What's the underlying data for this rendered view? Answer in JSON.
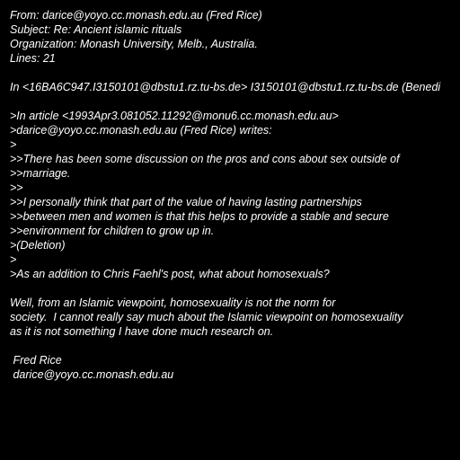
{
  "email": {
    "headers": {
      "from": "From: darice@yoyo.cc.monash.edu.au (Fred Rice)",
      "subject": "Subject: Re: Ancient islamic rituals",
      "organization": "Organization: Monash University, Melb., Australia.",
      "lines": "Lines: 21"
    },
    "in_reply_to": "In <16BA6C947.I3150101@dbstu1.rz.tu-bs.de> I3150101@dbstu1.rz.tu-bs.de (Benedi",
    "quoted": [
      ">In article <1993Apr3.081052.11292@monu6.cc.monash.edu.au>",
      ">darice@yoyo.cc.monash.edu.au (Fred Rice) writes:",
      ">",
      ">>There has been some discussion on the pros and cons about sex outside of",
      ">>marriage.",
      ">>",
      ">>I personally think that part of the value of having lasting partnerships",
      ">>between men and women is that this helps to provide a stable and secure",
      ">>environment for children to grow up in.",
      ">(Deletion)",
      ">",
      ">As an addition to Chris Faehl's post, what about homosexuals?"
    ],
    "body": [
      "Well, from an Islamic viewpoint, homosexuality is not the norm for",
      "society.  I cannot really say much about the Islamic viewpoint on homosexuality",
      "as it is not something I have done much research on."
    ],
    "signature": [
      " Fred Rice",
      " darice@yoyo.cc.monash.edu.au"
    ]
  }
}
